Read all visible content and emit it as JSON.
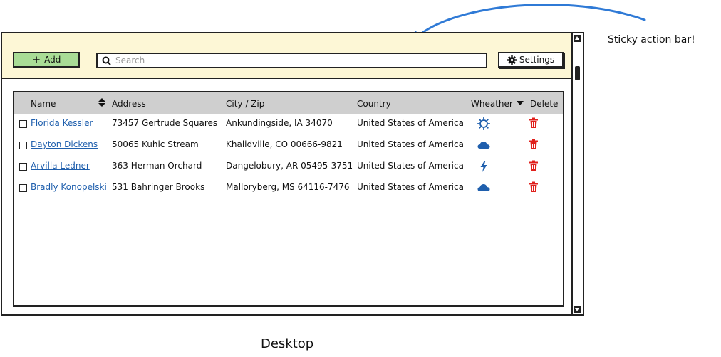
{
  "action_bar": {
    "add_label": "Add",
    "search_placeholder": "Search",
    "settings_label": "Settings"
  },
  "table": {
    "columns": [
      "Name",
      "Address",
      "City / Zip",
      "Country",
      "Wheather",
      "Delete"
    ],
    "rows": [
      {
        "name": "Florida Kessler",
        "address": "73457 Gertrude Squares",
        "city_zip": "Ankundingside, IA 34070",
        "country": "United States of America",
        "weather_icon": "sun-icon"
      },
      {
        "name": "Dayton Dickens",
        "address": "50065 Kuhic Stream",
        "city_zip": "Khalidville, CO 00666-9821",
        "country": "United States of America",
        "weather_icon": "cloud-icon"
      },
      {
        "name": "Arvilla Ledner",
        "address": "363 Herman Orchard",
        "city_zip": "Dangelobury, AR 05495-3751",
        "country": "United States of America",
        "weather_icon": "lightning-icon"
      },
      {
        "name": "Bradly Konopelski",
        "address": "531 Bahringer Brooks",
        "city_zip": "Malloryberg, MS 64116-7476",
        "country": "United States of America",
        "weather_icon": "cloud-icon"
      }
    ]
  },
  "annotation": "Sticky action bar!",
  "caption": "Desktop",
  "colors": {
    "action_bar_bg": "#fdf7d6",
    "add_button_bg": "#a9dc96",
    "header_bg": "#cfcfcf",
    "link": "#1f5fad",
    "weather_icon": "#1f5fad",
    "delete_icon": "#e0201c",
    "arrow": "#2f7ad6"
  }
}
